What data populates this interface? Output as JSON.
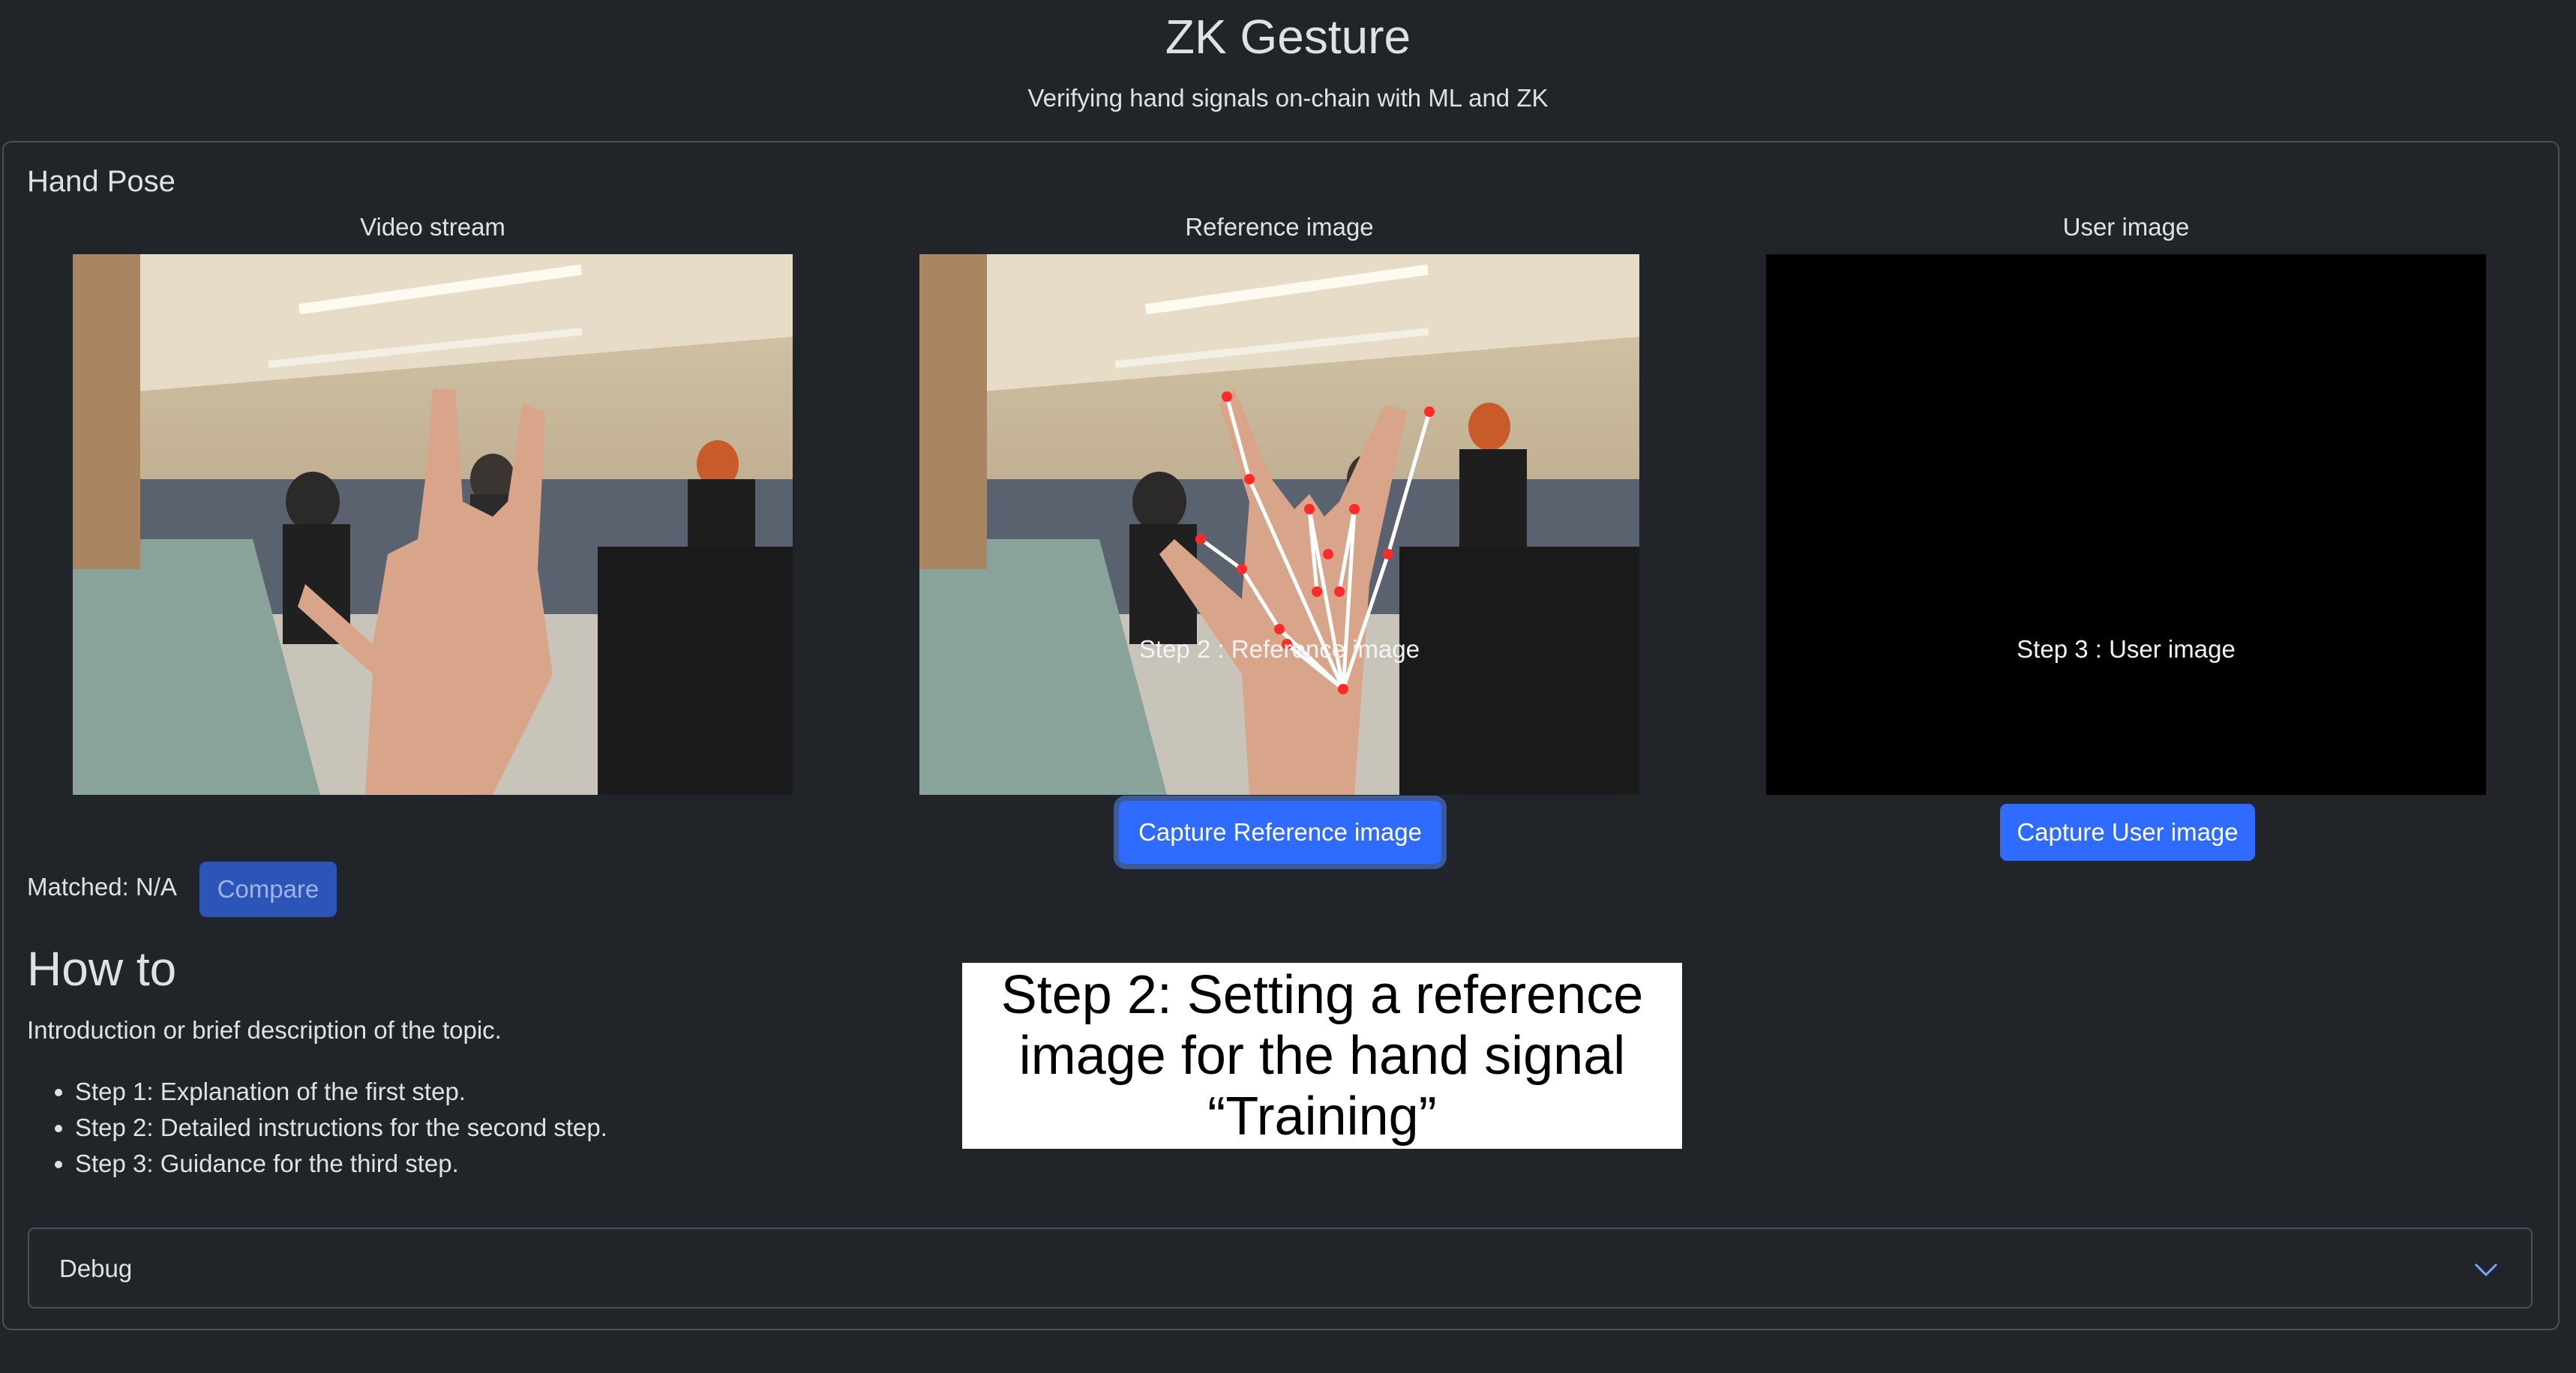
{
  "header": {
    "title": "ZK Gesture",
    "subtitle": "Verifying hand signals on-chain with ML and ZK"
  },
  "card": {
    "title": "Hand Pose",
    "panels": [
      {
        "label": "Video stream",
        "caption": ""
      },
      {
        "label": "Reference image",
        "caption": "Step 2 : Reference image"
      },
      {
        "label": "User image",
        "caption": "Step 3 : User image"
      }
    ],
    "buttons": {
      "capture_reference": "Capture Reference image",
      "capture_user": "Capture User image",
      "compare": "Compare"
    },
    "matched": "Matched: N/A"
  },
  "howto": {
    "title": "How to",
    "intro": "Introduction or brief description of the topic.",
    "steps": [
      "Step 1: Explanation of the first step.",
      "Step 2: Detailed instructions for the second step.",
      "Step 3: Guidance for the third step."
    ]
  },
  "step_box": {
    "lines": [
      "Step 2: Setting a reference",
      "image for the hand signal",
      "“Training”"
    ]
  },
  "debug": {
    "label": "Debug",
    "icon": "chevron-down-icon"
  },
  "colors": {
    "background": "#212529",
    "accent": "#2f6bff",
    "border": "#495057"
  }
}
